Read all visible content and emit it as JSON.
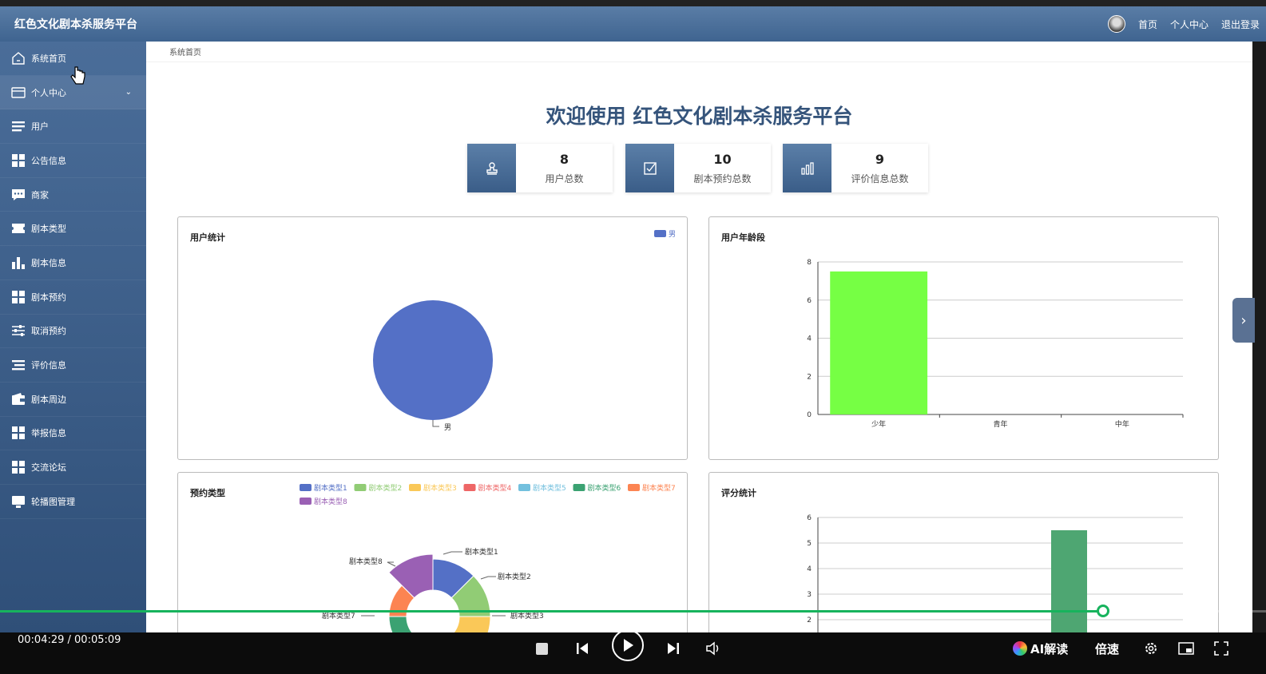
{
  "app": {
    "title": "红色文化剧本杀服务平台"
  },
  "topnav": {
    "home": "首页",
    "profile": "个人中心",
    "logout": "退出登录"
  },
  "sidebar": {
    "items": [
      {
        "label": "系统首页",
        "icon": "home-icon"
      },
      {
        "label": "个人中心",
        "icon": "card-icon"
      },
      {
        "label": "用户",
        "icon": "list-icon"
      },
      {
        "label": "公告信息",
        "icon": "grid-icon"
      },
      {
        "label": "商家",
        "icon": "chat-icon"
      },
      {
        "label": "剧本类型",
        "icon": "ticket-icon"
      },
      {
        "label": "剧本信息",
        "icon": "bar-icon"
      },
      {
        "label": "剧本预约",
        "icon": "grid-icon"
      },
      {
        "label": "取消预约",
        "icon": "sliders-icon"
      },
      {
        "label": "评价信息",
        "icon": "list-icon"
      },
      {
        "label": "剧本周边",
        "icon": "wallet-icon"
      },
      {
        "label": "举报信息",
        "icon": "grid-icon"
      },
      {
        "label": "交流论坛",
        "icon": "grid-icon"
      },
      {
        "label": "轮播图管理",
        "icon": "monitor-icon"
      }
    ]
  },
  "breadcrumb": "系统首页",
  "welcome": "欢迎使用 红色文化剧本杀服务平台",
  "stats": [
    {
      "value": "8",
      "label": "用户总数",
      "icon": "stamp-icon"
    },
    {
      "value": "10",
      "label": "剧本预约总数",
      "icon": "edit-icon"
    },
    {
      "value": "9",
      "label": "评价信息总数",
      "icon": "chart-icon"
    }
  ],
  "chart_data": [
    {
      "type": "pie",
      "title": "用户统计",
      "legend": [
        "男"
      ],
      "legend_position": "top-right",
      "slices": [
        {
          "name": "男",
          "value": 8,
          "color": "#5470c6"
        }
      ]
    },
    {
      "type": "bar",
      "title": "用户年龄段",
      "categories": [
        "少年",
        "青年",
        "中年"
      ],
      "values": [
        7.5,
        0,
        0
      ],
      "ylim": [
        0,
        8
      ],
      "yticks": [
        0,
        2,
        4,
        6,
        8
      ],
      "color": "#76ff44",
      "grid": true
    },
    {
      "type": "pie",
      "title": "预约类型",
      "legend_position": "top",
      "slices": [
        {
          "name": "剧本类型1",
          "value": 1,
          "color": "#5470c6"
        },
        {
          "name": "剧本类型2",
          "value": 1,
          "color": "#91cc75"
        },
        {
          "name": "剧本类型3",
          "value": 1,
          "color": "#fac858"
        },
        {
          "name": "剧本类型4",
          "value": 1,
          "color": "#ee6666"
        },
        {
          "name": "剧本类型5",
          "value": 1,
          "color": "#73c0de"
        },
        {
          "name": "剧本类型6",
          "value": 1,
          "color": "#3ba272"
        },
        {
          "name": "剧本类型7",
          "value": 1,
          "color": "#fc8452"
        },
        {
          "name": "剧本类型8",
          "value": 1,
          "color": "#9a60b4"
        }
      ]
    },
    {
      "type": "bar",
      "title": "评分统计",
      "yticks": [
        2,
        3,
        4,
        5,
        6
      ],
      "ylim": [
        1,
        6
      ],
      "bar_value": 5.5,
      "color": "#4ea672",
      "grid": true
    }
  ],
  "player": {
    "time": "00:04:29 / 00:05:09",
    "progress": 0.871,
    "ai_label": "AI解读",
    "speed_label": "倍速"
  }
}
